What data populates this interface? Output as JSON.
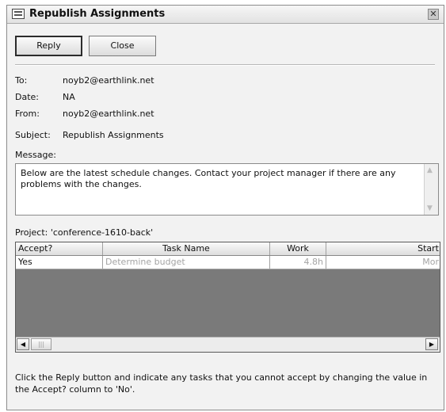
{
  "window": {
    "title": "Republish Assignments"
  },
  "toolbar": {
    "reply_label": "Reply",
    "close_label": "Close"
  },
  "header": {
    "to_label": "To:",
    "to_value": "noyb2@earthlink.net",
    "date_label": "Date:",
    "date_value": "NA",
    "from_label": "From:",
    "from_value": "noyb2@earthlink.net",
    "subject_label": "Subject:",
    "subject_value": "Republish Assignments"
  },
  "message": {
    "label": "Message:",
    "text": "Below are the latest schedule changes. Contact your project manager if there are any problems with the changes."
  },
  "project": {
    "label": "Project: 'conference-1610-back'"
  },
  "grid": {
    "columns": [
      "Accept?",
      "Task Name",
      "Work",
      "Start"
    ],
    "rows": [
      [
        "Yes",
        "Determine budget",
        "4.8h",
        "Mor"
      ]
    ]
  },
  "footer": {
    "text": "Click the Reply button and indicate any tasks that you cannot accept by changing the value in the Accept? column to 'No'."
  }
}
